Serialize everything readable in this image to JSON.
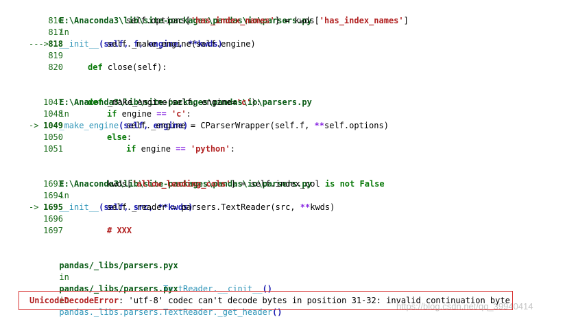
{
  "frames": [
    {
      "path": "E:\\Anaconda3\\lib\\site-packages\\pandas\\io\\parsers.py",
      "in_word": "in",
      "func": "__init__",
      "args": "(self, f, engine, **kwds)",
      "lines": [
        {
          "no": "816",
          "arrow": "",
          "code": "self.options['has_index_names'] = kwds['has_index_names']"
        },
        {
          "no": "817",
          "arrow": "",
          "code": ""
        },
        {
          "no": "818",
          "arrow": "--->",
          "code": "self._make_engine(self.engine)"
        },
        {
          "no": "819",
          "arrow": "",
          "code": ""
        },
        {
          "no": "820",
          "arrow": "",
          "code": "def close(self):"
        }
      ]
    },
    {
      "path": "E:\\Anaconda3\\lib\\site-packages\\pandas\\io\\parsers.py",
      "in_word": "in",
      "func": "_make_engine",
      "args": "(self, engine)",
      "lines": [
        {
          "no": "1047",
          "arrow": "",
          "code": "def _make_engine(self, engine='c'):"
        },
        {
          "no": "1048",
          "arrow": "",
          "code": "if engine == 'c':"
        },
        {
          "no": "1049",
          "arrow": "->",
          "code": "self._engine = CParserWrapper(self.f, **self.options)"
        },
        {
          "no": "1050",
          "arrow": "",
          "code": "else:"
        },
        {
          "no": "1051",
          "arrow": "",
          "code": "if engine == 'python':"
        }
      ]
    },
    {
      "path": "E:\\Anaconda3\\lib\\site-packages\\pandas\\io\\parsers.py",
      "in_word": "in",
      "func": "__init__",
      "args": "(self, src, **kwds)",
      "lines": [
        {
          "no": "1693",
          "arrow": "",
          "code": "kwds['allow_leading_cols'] = self.index_col is not False"
        },
        {
          "no": "1694",
          "arrow": "",
          "code": ""
        },
        {
          "no": "1695",
          "arrow": "->",
          "code": "self._reader = parsers.TextReader(src, **kwds)"
        },
        {
          "no": "1696",
          "arrow": "",
          "code": ""
        },
        {
          "no": "1697",
          "arrow": "",
          "code": "# XXX"
        }
      ]
    }
  ],
  "pyx_frames": [
    {
      "path": "pandas/_libs/parsers.pyx",
      "in_word": "in",
      "func": "pandas._libs.parsers.TextReader.__cinit__",
      "call": "()"
    },
    {
      "path": "pandas/_libs/parsers.pyx",
      "in_word": "in",
      "func": "pandas._libs.parsers.TextReader._get_header",
      "call": "()"
    }
  ],
  "error": {
    "name": "UnicodeDecodeError",
    "message": ": 'utf-8' codec can't decode bytes in position 31-32: invalid continuation byte"
  },
  "watermark": "https://blog.csdn.net/qq_39940414",
  "colors": {
    "path": "#0b5c17",
    "function": "#2f95b8",
    "args": "#1b1bb0",
    "keyword": "#0b7a0b",
    "string": "#b22222",
    "error_border": "#d62d2d"
  }
}
